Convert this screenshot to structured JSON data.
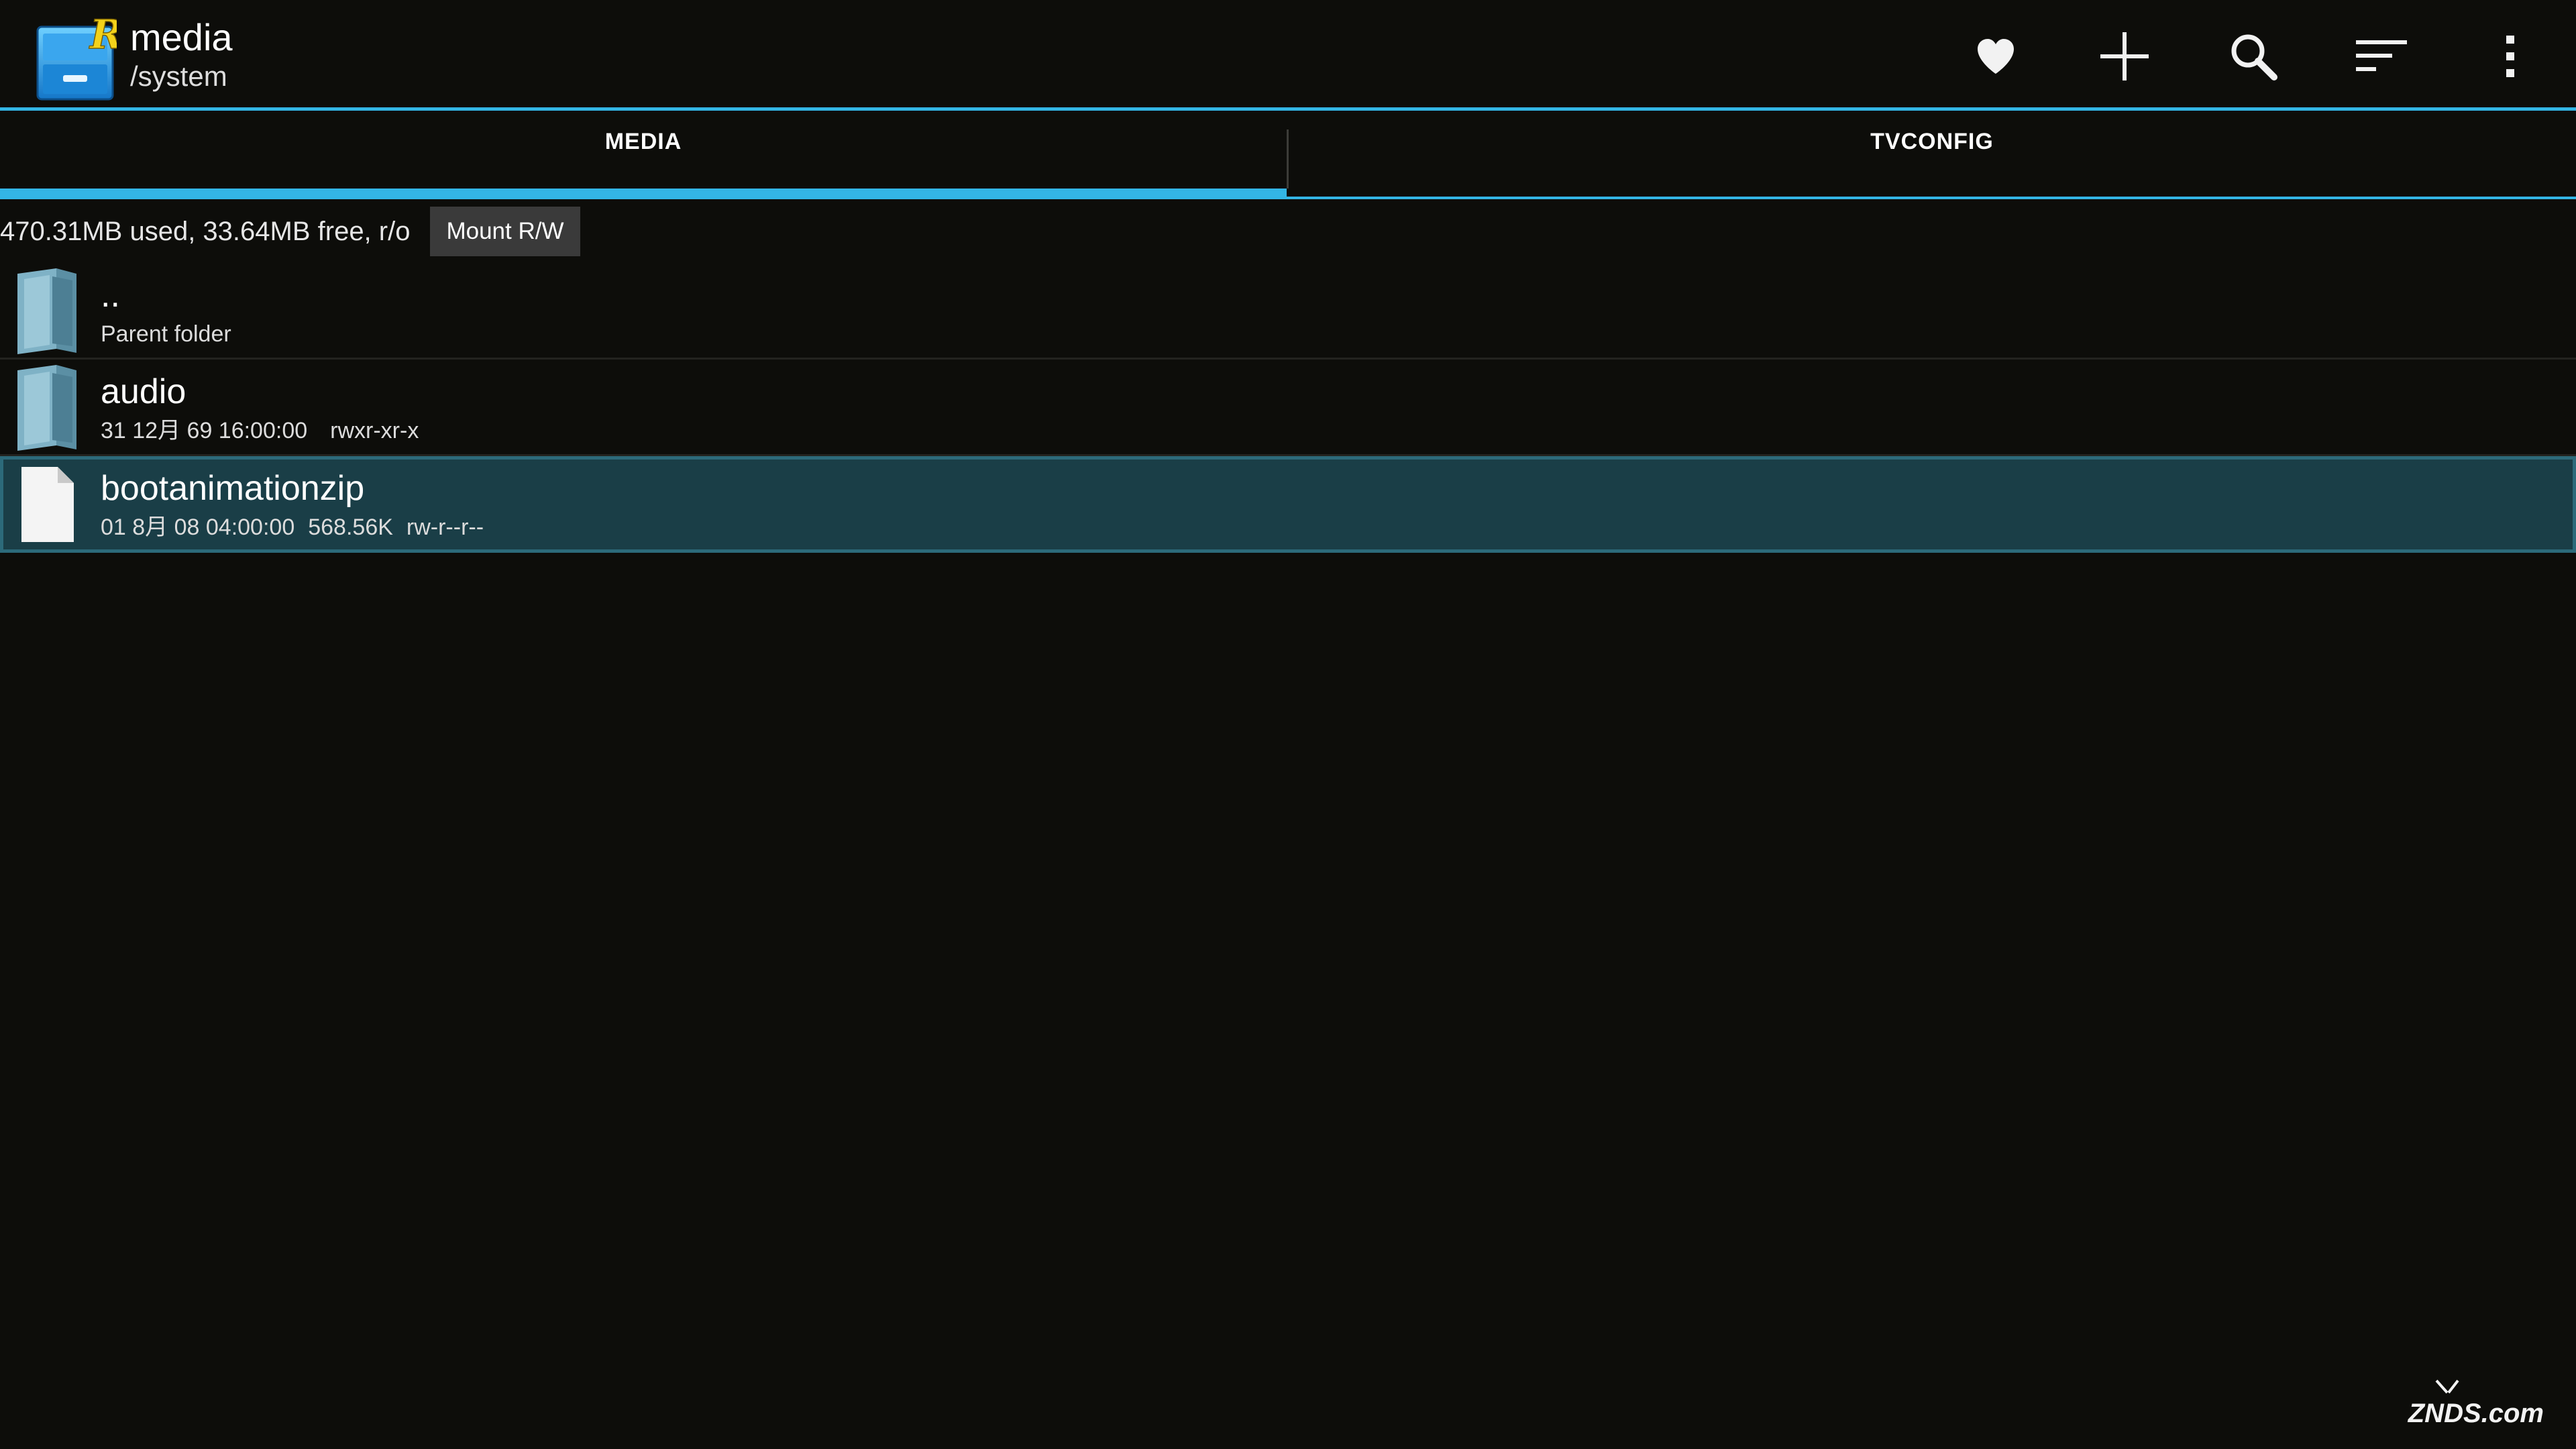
{
  "actionbar": {
    "title": "media",
    "subtitle": "/system",
    "actions": [
      {
        "name": "favorite-button",
        "icon": "heart-icon"
      },
      {
        "name": "new-button",
        "icon": "plus-icon"
      },
      {
        "name": "search-button",
        "icon": "search-icon"
      },
      {
        "name": "sort-button",
        "icon": "sort-icon"
      },
      {
        "name": "overflow-menu-button",
        "icon": "more-vert-icon"
      }
    ]
  },
  "tabs": [
    {
      "label": "MEDIA",
      "selected": true
    },
    {
      "label": "TVCONFIG",
      "selected": false
    }
  ],
  "storage": {
    "info": "470.31MB used, 33.64MB free, r/o",
    "mount_button": "Mount R/W"
  },
  "files": [
    {
      "name": "..",
      "detail": "Parent folder",
      "type": "folder",
      "selected": false
    },
    {
      "name": "audio",
      "date": "31 12月 69 16:00:00",
      "size": "",
      "perms": "rwxr-xr-x",
      "type": "folder",
      "selected": false
    },
    {
      "name": "bootanimationzip",
      "date": "01 8月 08 04:00:00",
      "size": "568.56K",
      "perms": "rw-r--r--",
      "type": "file",
      "selected": true
    }
  ],
  "watermark": {
    "text": "ZNDS.com"
  },
  "colors": {
    "accent": "#33b5e5",
    "background": "#0d0d0a",
    "selected_row": "#1a3e47",
    "button": "#3a3a3a"
  }
}
